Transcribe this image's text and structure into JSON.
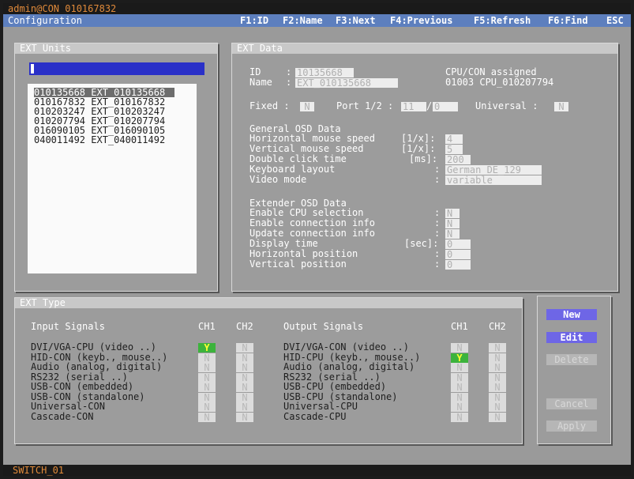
{
  "window": {
    "user_title": "admin@CON 010167832",
    "config_label": "Configuration"
  },
  "fkeys": [
    "F1:ID",
    "F2:Name",
    "F3:Next",
    "F4:Previous",
    "F5:Refresh",
    "F6:Find",
    "ESC"
  ],
  "ext_units": {
    "title": "EXT Units",
    "search_value": "",
    "items": [
      "010135668 EXT_010135668",
      "010167832 EXT_010167832",
      "010203247 EXT_010203247",
      "010207794 EXT_010207794",
      "016090105 EXT_016090105",
      "040011492 EXT_040011492"
    ],
    "selected_index": 0
  },
  "ext_data": {
    "title": "EXT Data",
    "id_label": "ID",
    "id_value": "10135668",
    "name_label": "Name",
    "name_value": "EXT_010135668",
    "sep": ":",
    "cpu_con_label": "CPU/CON assigned",
    "cpu_con_value": "01003 CPU_010207794",
    "fixed_label": "Fixed :",
    "fixed_value": "N",
    "port_label": "Port 1/2 :",
    "port1_value": "11",
    "port_slash": "/",
    "port2_value": "0",
    "universal_label": "Universal :",
    "universal_value": "N",
    "general_title": "General OSD Data",
    "general_rows": [
      {
        "label": "Horizontal mouse speed",
        "unit": "[1/x]:",
        "value": "4"
      },
      {
        "label": "Vertical mouse speed",
        "unit": "[1/x]:",
        "value": "5"
      },
      {
        "label": "Double click time",
        "unit": "[ms]:",
        "value": "200"
      },
      {
        "label": "Keyboard layout",
        "unit": ":",
        "value": "German DE_129"
      },
      {
        "label": "Video mode",
        "unit": ":",
        "value": "variable"
      }
    ],
    "extender_title": "Extender OSD Data",
    "extender_rows": [
      {
        "label": "Enable CPU selection",
        "unit": ":",
        "value": "N"
      },
      {
        "label": "Enable connection info",
        "unit": ":",
        "value": "N"
      },
      {
        "label": "Update connection info",
        "unit": ":",
        "value": "N"
      },
      {
        "label": "Display time",
        "unit": "[sec]:",
        "value": "0"
      },
      {
        "label": "Horizontal position",
        "unit": ":",
        "value": "0"
      },
      {
        "label": "Vertical position",
        "unit": ":",
        "value": "0"
      }
    ]
  },
  "ext_type": {
    "title": "EXT Type",
    "input_header": "Input Signals",
    "output_header": "Output Signals",
    "ch1": "CH1",
    "ch2": "CH2",
    "inputs": [
      {
        "label": "DVI/VGA-CPU (video ..)",
        "ch1": "Y",
        "ch2": "N"
      },
      {
        "label": "HID-CON (keyb., mouse..)",
        "ch1": "N",
        "ch2": "N"
      },
      {
        "label": "Audio (analog, digital)",
        "ch1": "N",
        "ch2": "N"
      },
      {
        "label": "RS232 (serial ..)",
        "ch1": "N",
        "ch2": "N"
      },
      {
        "label": "USB-CON (embedded)",
        "ch1": "N",
        "ch2": "N"
      },
      {
        "label": "USB-CON (standalone)",
        "ch1": "N",
        "ch2": "N"
      },
      {
        "label": "Universal-CON",
        "ch1": "N",
        "ch2": "N"
      },
      {
        "label": "Cascade-CON",
        "ch1": "N",
        "ch2": "N"
      }
    ],
    "outputs": [
      {
        "label": "DVI/VGA-CON (video ..)",
        "ch1": "N",
        "ch2": "N"
      },
      {
        "label": "HID-CPU (keyb., mouse..)",
        "ch1": "Y",
        "ch2": "N"
      },
      {
        "label": "Audio (analog, digital)",
        "ch1": "N",
        "ch2": "N"
      },
      {
        "label": "RS232 (serial ..)",
        "ch1": "N",
        "ch2": "N"
      },
      {
        "label": "USB-CPU (embedded)",
        "ch1": "N",
        "ch2": "N"
      },
      {
        "label": "USB-CPU (standalone)",
        "ch1": "N",
        "ch2": "N"
      },
      {
        "label": "Universal-CPU",
        "ch1": "N",
        "ch2": "N"
      },
      {
        "label": "Cascade-CPU",
        "ch1": "N",
        "ch2": "N"
      }
    ]
  },
  "buttons": {
    "new": "New",
    "edit": "Edit",
    "delete": "Delete",
    "cancel": "Cancel",
    "apply": "Apply"
  },
  "status": {
    "switch_name": "SWITCH_01"
  }
}
